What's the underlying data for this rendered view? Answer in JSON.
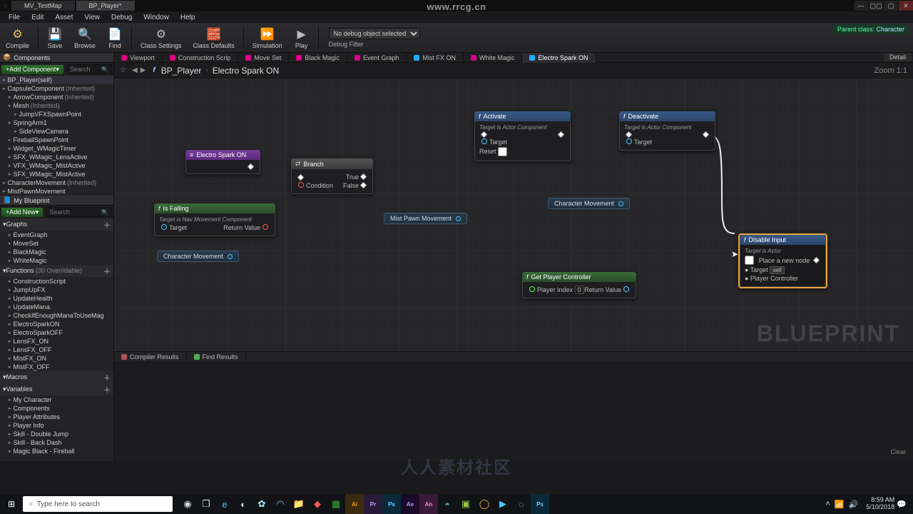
{
  "titlebar": {
    "tab1": "MV_TestMap",
    "tab2": "BP_Player*"
  },
  "menu": [
    "File",
    "Edit",
    "Asset",
    "View",
    "Debug",
    "Window",
    "Help"
  ],
  "toolbar": {
    "compile": "Compile",
    "save": "Save",
    "browse": "Browse",
    "find": "Find",
    "class_settings": "Class Settings",
    "class_defaults": "Class Defaults",
    "simulation": "Simulation",
    "play": "Play",
    "debug_selected": "No debug object selected",
    "debug_filter": "Debug Filter",
    "parent_class_label": "Parent class:",
    "parent_class_value": "Character",
    "detail_tab": "Detail"
  },
  "components": {
    "panel_title": "Components",
    "add_label": "Add Component",
    "search_placeholder": "Search",
    "self": "BP_Player(self)",
    "items": [
      {
        "name": "CapsuleComponent",
        "suffix": "(Inherited)",
        "indent": 0
      },
      {
        "name": "ArrowComponent",
        "suffix": "(Inherited)",
        "indent": 1
      },
      {
        "name": "Mesh",
        "suffix": "(Inherited)",
        "indent": 1
      },
      {
        "name": "JumpVFXSpawnPoint",
        "suffix": "",
        "indent": 2
      },
      {
        "name": "SpringArm1",
        "suffix": "",
        "indent": 1
      },
      {
        "name": "SideViewCamera",
        "suffix": "",
        "indent": 2
      },
      {
        "name": "FireballSpawnPoint",
        "suffix": "",
        "indent": 1
      },
      {
        "name": "Widget_WMagicTimer",
        "suffix": "",
        "indent": 1
      },
      {
        "name": "SFX_WMagic_LensActive",
        "suffix": "",
        "indent": 1
      },
      {
        "name": "VFX_WMagic_MistActive",
        "suffix": "",
        "indent": 1
      },
      {
        "name": "SFX_WMagic_MistActive",
        "suffix": "",
        "indent": 1
      },
      {
        "name": "CharacterMovement",
        "suffix": "(Inherited)",
        "indent": 0
      },
      {
        "name": "MistPawnMovement",
        "suffix": "",
        "indent": 0
      }
    ]
  },
  "myblueprint": {
    "panel_title": "My Blueprint",
    "add_label": "Add New",
    "search_placeholder": "Search",
    "sections": [
      {
        "title": "Graphs",
        "items": [
          "EventGraph",
          "MoveSet",
          "BlackMagic",
          "WhiteMagic"
        ]
      },
      {
        "title": "Functions",
        "hint": "(30 Overridable)",
        "items": [
          "ConstructionScript",
          "JumpUpFX",
          "UpdateHealth",
          "UpdateMana",
          "CheckIfEnoughManaToUseMag",
          "ElectroSparkON",
          "ElectroSparkOFF",
          "LensFX_ON",
          "LensFX_OFF",
          "MistFX_ON",
          "MistFX_OFF"
        ]
      },
      {
        "title": "Macros",
        "items": []
      },
      {
        "title": "Variables",
        "items": [
          "My Character",
          "Components",
          "Player Attributes",
          "Player Info",
          "Skill - Double Jump",
          "Skill - Back Dash",
          "Magic Black - Fireball"
        ]
      }
    ]
  },
  "graph_tabs": [
    "Viewport",
    "Construction Scrip",
    "Move Set",
    "Black Magic",
    "Event Graph",
    "Mist FX ON",
    "White Magic",
    "Electro Spark ON"
  ],
  "graph_tabs_active": 7,
  "breadcrumb": {
    "parent": "BP_Player",
    "current": "Electro Spark ON",
    "zoom": "Zoom 1:1"
  },
  "nodes": {
    "event": {
      "title": "Electro Spark ON"
    },
    "branch": {
      "title": "Branch",
      "true": "True",
      "false": "False",
      "cond": "Condition"
    },
    "isfalling": {
      "title": "Is Falling",
      "sub": "Target is Nav Movement Component",
      "target": "Target",
      "ret": "Return Value"
    },
    "activate": {
      "title": "Activate",
      "sub": "Target is Actor Component",
      "target": "Target",
      "reset": "Reset"
    },
    "deactivate": {
      "title": "Deactivate",
      "sub": "Target is Actor Component",
      "target": "Target"
    },
    "getpc": {
      "title": "Get Player Controller",
      "pidx": "Player Index",
      "pidx_val": "0",
      "ret": "Return Value"
    },
    "disable": {
      "title": "Disable Input",
      "sub": "Target is Actor",
      "place": "Place a new node",
      "target": "Target",
      "self": "self",
      "pc": "Player Controller"
    },
    "var_cm1": "Character Movement",
    "var_cm2": "Character Movement",
    "var_mist": "Mist Pawn Movement"
  },
  "results": {
    "compiler": "Compiler Results",
    "find": "Find Results",
    "clear": "Clear"
  },
  "taskbar": {
    "search_placeholder": "Type here to search",
    "time": "8:59 AM",
    "date": "5/10/2018"
  },
  "watermark": {
    "center": "人人素材社区",
    "top": "www.rrcg.cn"
  }
}
